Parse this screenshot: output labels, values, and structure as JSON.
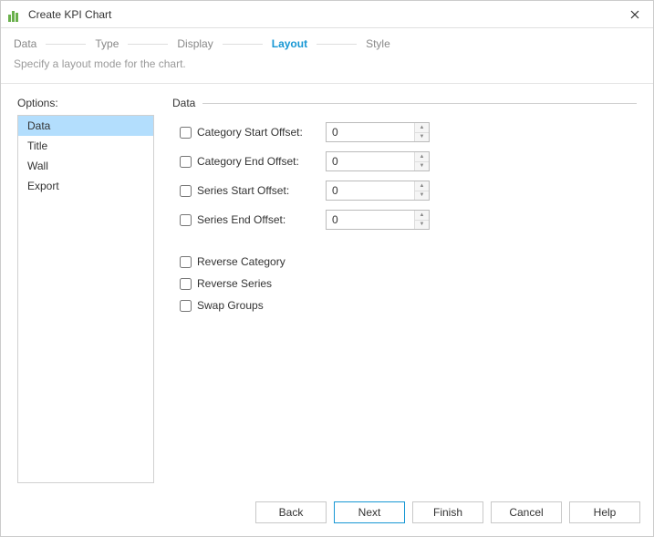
{
  "title": "Create KPI Chart",
  "steps": {
    "data": "Data",
    "type": "Type",
    "display": "Display",
    "layout": "Layout",
    "style": "Style"
  },
  "subtitle": "Specify a layout mode for the chart.",
  "options_label": "Options:",
  "options_items": {
    "data": "Data",
    "title": "Title",
    "wall": "Wall",
    "export": "Export"
  },
  "section": {
    "title": "Data"
  },
  "fields": {
    "category_start_offset": {
      "label": "Category Start Offset:",
      "value": "0"
    },
    "category_end_offset": {
      "label": "Category End Offset:",
      "value": "0"
    },
    "series_start_offset": {
      "label": "Series Start Offset:",
      "value": "0"
    },
    "series_end_offset": {
      "label": "Series End Offset:",
      "value": "0"
    },
    "reverse_category": {
      "label": "Reverse Category"
    },
    "reverse_series": {
      "label": "Reverse Series"
    },
    "swap_groups": {
      "label": "Swap Groups"
    }
  },
  "buttons": {
    "back": "Back",
    "next": "Next",
    "finish": "Finish",
    "cancel": "Cancel",
    "help": "Help"
  }
}
